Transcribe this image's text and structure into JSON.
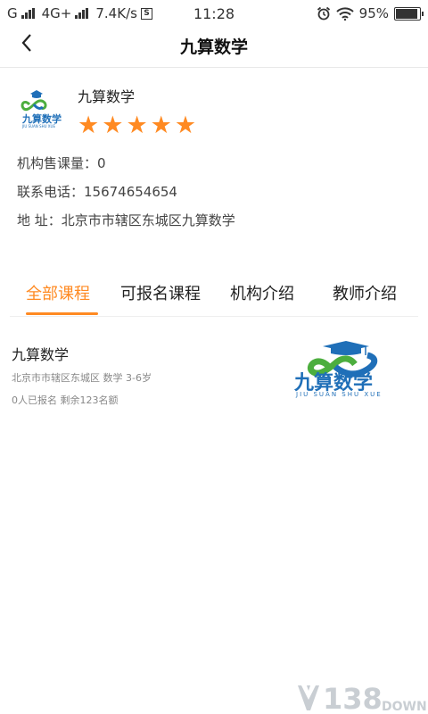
{
  "status_bar": {
    "network_g": "G",
    "network_4g": "4G+",
    "speed": "7.4K/s",
    "sim_icon_char": "S",
    "time": "11:28",
    "battery": "95%"
  },
  "nav": {
    "title": "九算数学"
  },
  "org": {
    "name": "九算数学",
    "rating_stars": 5,
    "star_glyph": "★",
    "sales": "机构售课量：0",
    "phone": "联系电话：15674654654",
    "address": "地 址：北京市市辖区东城区九算数学"
  },
  "tabs": [
    {
      "label": "全部课程",
      "active": true
    },
    {
      "label": "可报名课程",
      "active": false
    },
    {
      "label": "机构介绍",
      "active": false
    },
    {
      "label": "教师介绍",
      "active": false
    }
  ],
  "course": {
    "title": "九算数学",
    "meta": "北京市市辖区东城区  数学  3-6岁",
    "enroll": "0人已报名  剩余123名额",
    "logo_text": "九算数学",
    "logo_subtext": "JIU SUAN SHU XUE"
  },
  "watermark": {
    "number": "138",
    "word": "DOWN"
  },
  "colors": {
    "accent": "#ff8a22",
    "logo_blue": "#1f6fb8",
    "logo_green": "#4cae3e"
  }
}
